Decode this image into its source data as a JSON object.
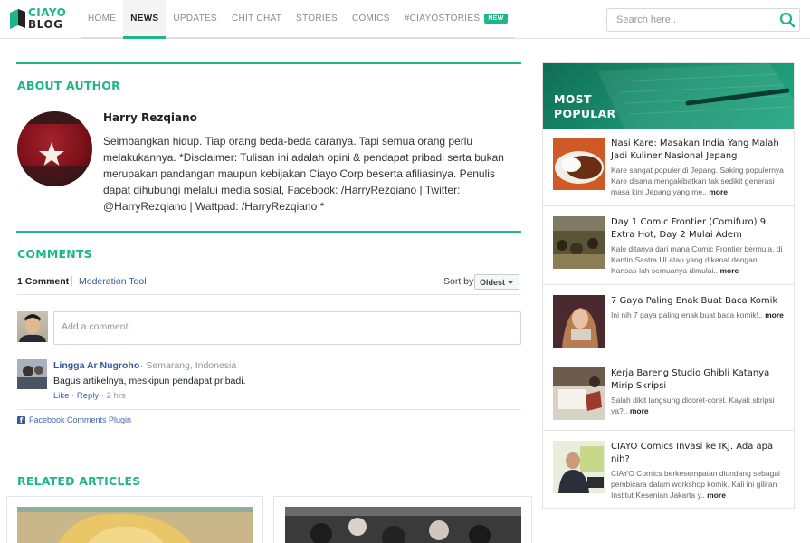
{
  "logo": {
    "line1": "CIAYO",
    "line2": "BLOG"
  },
  "nav": {
    "items": [
      {
        "label": "HOME"
      },
      {
        "label": "NEWS"
      },
      {
        "label": "UPDATES"
      },
      {
        "label": "CHIT CHAT"
      },
      {
        "label": "STORIES"
      },
      {
        "label": "COMICS"
      },
      {
        "label": "#CIAYOSTORIES",
        "badge": "NEW"
      }
    ],
    "active": "NEWS"
  },
  "search": {
    "placeholder": "Search here.."
  },
  "about": {
    "heading": "ABOUT AUTHOR",
    "name": "Harry Rezqiano",
    "bio": "Seimbangkan hidup. Tiap orang beda-beda caranya. Tapi semua orang perlu melakukannya. *Disclaimer: Tulisan ini adalah opini & pendapat pribadi serta bukan merupakan pandangan maupun kebijakan Ciayo Corp beserta afiliasinya. Penulis dapat dihubungi melalui media sosial, Facebook: /HarryRezqiano | Twitter: @HarryRezqiano | Wattpad: /HarryRezqiano *"
  },
  "comments": {
    "heading": "COMMENTS",
    "count_label": "1 Comment",
    "moderation_label": "Moderation Tool",
    "sort_label": "Sort by",
    "sort_value": "Oldest",
    "input_placeholder": "Add a comment...",
    "items": [
      {
        "author": "Lingga Ar Nugroho",
        "location": "· Semarang, Indonesia",
        "text": "Bagus artikelnya, meskipun pendapat pribadi.",
        "like": "Like",
        "reply": "Reply",
        "time": "2 hrs"
      }
    ],
    "plugin_label": "Facebook Comments Plugin"
  },
  "related": {
    "heading": "RELATED ARTICLES"
  },
  "sidebar": {
    "title_line1": "MOST",
    "title_line2": "POPULAR",
    "items": [
      {
        "title": "Nasi Kare: Masakan India Yang Malah Jadi Kuliner Nasional Jepang",
        "desc": "Kare sangat populer di Jepang. Saking populernya Kare disana mengakibatkan tak sedikit generasi masa kini Jepang yang me..",
        "more": "more"
      },
      {
        "title": "Day 1 Comic Frontier (Comifuro) 9 Extra Hot, Day 2 Mulai Adem",
        "desc": "Kalo ditanya dari mana Comic Frontier bermula, di Kantin Sastra UI atau yang dikenal dengan Kansas-lah semuanya dimulai..",
        "more": "more"
      },
      {
        "title": "7 Gaya Paling Enak Buat Baca Komik",
        "desc": "Ini nih 7 gaya paling enak buat baca komik!..",
        "more": "more"
      },
      {
        "title": "Kerja Bareng Studio Ghibli Katanya Mirip Skripsi",
        "desc": "Salah dikit langsung dicoret-coret. Kayak skripsi ya?..",
        "more": "more"
      },
      {
        "title": "CIAYO Comics Invasi ke IKJ. Ada apa nih?",
        "desc": "CIAYO Comics berkesempatan diundang sebagai pembicara dalam workshop komik. Kali ini giliran Institut Kesenian Jakarta y..",
        "more": "more"
      }
    ]
  },
  "colors": {
    "accent": "#1fb58a",
    "facebook_link": "#365899"
  }
}
